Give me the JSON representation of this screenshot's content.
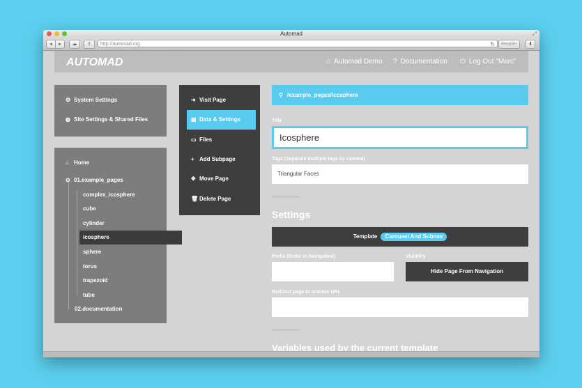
{
  "browser": {
    "window_title": "Automad",
    "url": "http://automad.org",
    "reader_label": "Reader"
  },
  "header": {
    "logo": "AUTOMAD",
    "nav": [
      {
        "label": "Automad Demo",
        "icon": "home-icon"
      },
      {
        "label": "Documentation",
        "icon": "question-circle-icon"
      },
      {
        "label": "Log Out \"Marc\"",
        "icon": "power-icon"
      }
    ]
  },
  "sidebar": {
    "settings": [
      {
        "label": "System Settings",
        "icon": "gear-icon"
      },
      {
        "label": "Site Settings & Shared Files",
        "icon": "globe-icon"
      }
    ],
    "tree": {
      "home": "Home",
      "folder": "01.example_pages",
      "children": [
        "complex_icosphere",
        "cube",
        "cylinder",
        "icosphere",
        "sphere",
        "torus",
        "trapezoid",
        "tube"
      ],
      "other": "02.documentation",
      "selected": "icosphere"
    }
  },
  "context_menu": {
    "items": [
      {
        "label": "Visit Page",
        "icon": "arrow-right-icon"
      },
      {
        "label": "Data & Settings",
        "icon": "file-icon",
        "active": true
      },
      {
        "label": "Files",
        "icon": "folder-icon"
      },
      {
        "label": "Add Subpage",
        "icon": "plus-icon"
      },
      {
        "label": "Move Page",
        "icon": "move-icon"
      },
      {
        "label": "Delete Page",
        "icon": "trash-icon"
      }
    ]
  },
  "main": {
    "path": "/example_pages/icosphere",
    "title_label": "Title",
    "title_value": "Icosphere",
    "tags_label": "Tags (Separate multiple tags by comma)",
    "tags_value": "Triangular Faces",
    "settings_heading": "Settings",
    "template_label": "Template",
    "template_value": "Carousel And Subnav",
    "prefix_label": "Prefix (Order in Navigation)",
    "prefix_value": "",
    "visibility_label": "Visibility",
    "hide_button": "Hide Page From Navigation",
    "redirect_label": "Redirect page to another URL",
    "redirect_value": "",
    "variables_heading": "Variables used by the current template"
  },
  "colors": {
    "background": "#5ccfef",
    "accent": "#59cbef",
    "panel_dark": "#3e3e3e",
    "panel_gray": "#7d7d7d"
  }
}
